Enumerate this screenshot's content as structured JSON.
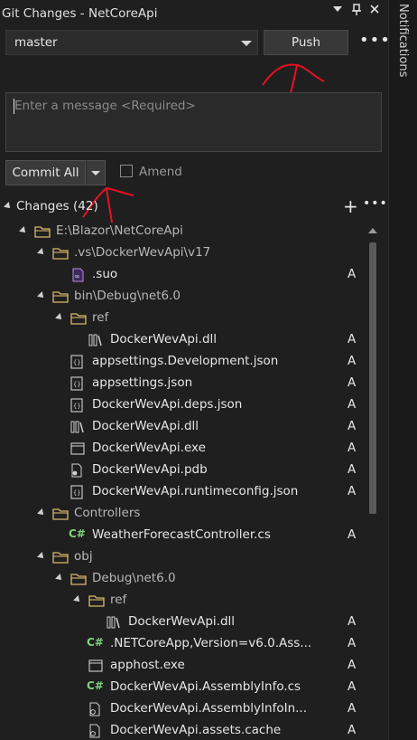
{
  "window": {
    "title": "Git Changes - NetCoreApi"
  },
  "sidebar": {
    "label": "Notifications"
  },
  "branch": {
    "name": "master"
  },
  "toolbar": {
    "push_label": "Push",
    "more_label": "•••"
  },
  "message": {
    "placeholder": "Enter a message <Required>"
  },
  "commit": {
    "label": "Commit All",
    "amend_label": "Amend"
  },
  "changes": {
    "header": "Changes (42)",
    "more_label": "•••",
    "add_label": "+"
  },
  "tree": [
    {
      "label": "E:\\Blazor\\NetCoreApi",
      "type": "folder",
      "status": ""
    },
    {
      "label": ".vs\\DockerWevApi\\v17",
      "type": "folder",
      "status": ""
    },
    {
      "label": ".suo",
      "type": "suo",
      "status": "A"
    },
    {
      "label": "bin\\Debug\\net6.0",
      "type": "folder",
      "status": ""
    },
    {
      "label": "ref",
      "type": "folder",
      "status": ""
    },
    {
      "label": "DockerWevApi.dll",
      "type": "dll",
      "status": "A"
    },
    {
      "label": "appsettings.Development.json",
      "type": "json",
      "status": "A"
    },
    {
      "label": "appsettings.json",
      "type": "json",
      "status": "A"
    },
    {
      "label": "DockerWevApi.deps.json",
      "type": "json",
      "status": "A"
    },
    {
      "label": "DockerWevApi.dll",
      "type": "dll",
      "status": "A"
    },
    {
      "label": "DockerWevApi.exe",
      "type": "exe",
      "status": "A"
    },
    {
      "label": "DockerWevApi.pdb",
      "type": "pdb",
      "status": "A"
    },
    {
      "label": "DockerWevApi.runtimeconfig.json",
      "type": "json",
      "status": "A"
    },
    {
      "label": "Controllers",
      "type": "folder",
      "status": ""
    },
    {
      "label": "WeatherForecastController.cs",
      "type": "cs",
      "status": "A"
    },
    {
      "label": "obj",
      "type": "folder",
      "status": ""
    },
    {
      "label": "Debug\\net6.0",
      "type": "folder",
      "status": ""
    },
    {
      "label": "ref",
      "type": "folder",
      "status": ""
    },
    {
      "label": "DockerWevApi.dll",
      "type": "dll",
      "status": "A"
    },
    {
      "label": ".NETCoreApp,Version=v6.0.Ass...",
      "type": "cs",
      "status": "A"
    },
    {
      "label": "apphost.exe",
      "type": "exe",
      "status": "A"
    },
    {
      "label": "DockerWevApi.AssemblyInfo.cs",
      "type": "cs",
      "status": "A"
    },
    {
      "label": "DockerWevApi.AssemblyInfoIn...",
      "type": "cache",
      "status": "A"
    },
    {
      "label": "DockerWevApi.assets.cache",
      "type": "cache",
      "status": "A"
    }
  ],
  "colors": {
    "folder": "#d9b86b",
    "csharp": "#7fd37f",
    "accent_annotation": "#e81123"
  }
}
